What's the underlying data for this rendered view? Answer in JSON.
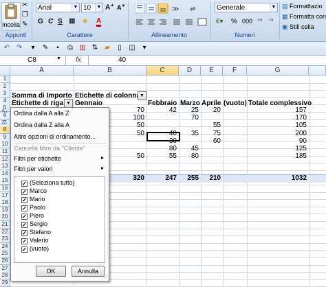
{
  "ribbon": {
    "paste_label": "Incolla",
    "font_name": "Arial",
    "font_size": "10",
    "bold": "G",
    "italic": "C",
    "underline": "S",
    "font_color_glyph": "A",
    "number_format": "Generale",
    "percent": "%",
    "thousands": "000",
    "cond_format": "Formattazio",
    "table_format": "Formatta con",
    "cell_styles": "Stili cella",
    "groups": [
      "Appunti",
      "Carattere",
      "Allineamento",
      "Numeri"
    ]
  },
  "formula_bar": {
    "cell_ref": "C8",
    "fx": "fx",
    "value": "40"
  },
  "columns": [
    "A",
    "B",
    "C",
    "D",
    "E",
    "F",
    "G"
  ],
  "rows": [
    "1",
    "2",
    "3",
    "4",
    "5",
    "6",
    "7",
    "8",
    "9",
    "10",
    "11",
    "12",
    "13",
    "14",
    "15",
    "16",
    "17",
    "18",
    "19",
    "20",
    "21",
    "22",
    "23",
    "24",
    "25",
    "26",
    "27",
    "28",
    "29"
  ],
  "pivot": {
    "data_label": "Somma di Importo",
    "col_label": "Etichette di colonna",
    "row_label": "Etichette di riga",
    "headers": [
      "Gennaio",
      "Febbraio",
      "Marzo",
      "Aprile",
      "(vuoto)",
      "Totale complessivo"
    ],
    "rows": [
      [
        "70",
        "42",
        "25",
        "20",
        "",
        "157"
      ],
      [
        "100",
        "",
        "70",
        "",
        "",
        "170"
      ],
      [
        "50",
        "",
        "",
        "55",
        "",
        "105"
      ],
      [
        "50",
        "40",
        "35",
        "75",
        "",
        "200"
      ],
      [
        "",
        "30",
        "",
        "60",
        "",
        "90"
      ],
      [
        "",
        "80",
        "45",
        "",
        "",
        "125"
      ],
      [
        "50",
        "55",
        "80",
        "",
        "",
        "185"
      ]
    ],
    "totals": [
      "320",
      "247",
      "255",
      "210",
      "",
      "1032"
    ]
  },
  "filter_menu": {
    "sort_asc": "Ordina dalla A alla Z",
    "sort_desc": "Ordina dalla Z alla A",
    "more_sort": "Altre opzioni di ordinamento...",
    "clear_filter": "Cancella filtro da \"Cliente\"",
    "label_filters": "Filtri per etichette",
    "value_filters": "Filtri per valori",
    "items": [
      "(Seleziona tutto)",
      "Marco",
      "Mario",
      "Paolo",
      "Piero",
      "Sergio",
      "Stefano",
      "Valerio",
      "(vuoto)"
    ],
    "ok": "OK",
    "cancel": "Annulla"
  }
}
